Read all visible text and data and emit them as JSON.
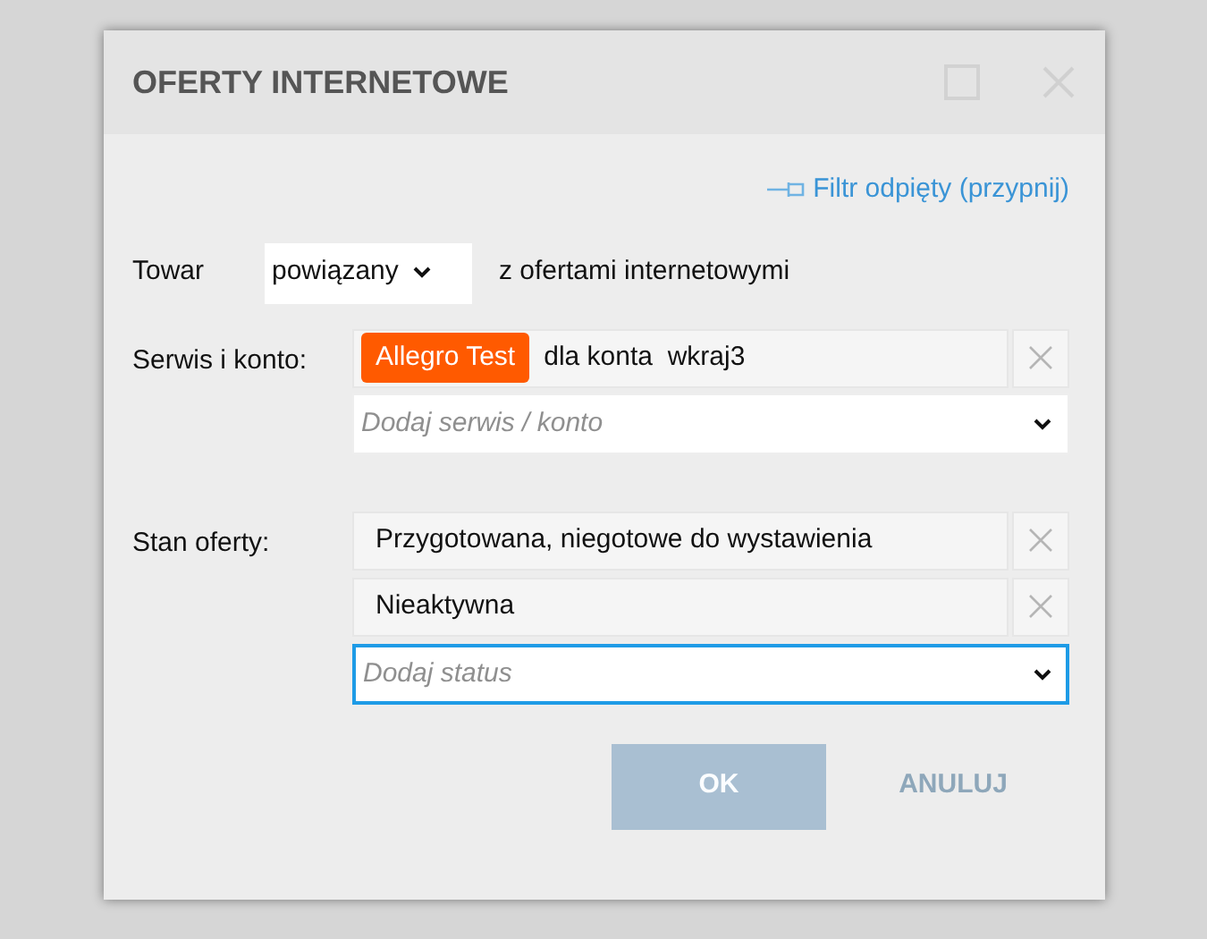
{
  "window": {
    "title": "OFERTY INTERNETOWE"
  },
  "filter_link": "Filtr odpięty (przypnij)",
  "product": {
    "label": "Towar",
    "select_value": "powiązany",
    "suffix": "z ofertami internetowymi"
  },
  "service": {
    "label": "Serwis i konto:",
    "entries": [
      {
        "tag": "Allegro Test",
        "color": "#ff5a00",
        "text": "dla konta  wkraj3"
      }
    ],
    "placeholder": "Dodaj serwis / konto",
    "focused": false
  },
  "status": {
    "label": "Stan oferty:",
    "entries": [
      {
        "text": "Przygotowana, niegotowe do wystawienia"
      },
      {
        "text": "Nieaktywna"
      }
    ],
    "placeholder": "Dodaj status",
    "focused": true
  },
  "buttons": [
    {
      "label": "OK",
      "kind": "primary",
      "disabled": true
    },
    {
      "label": "ANULUJ",
      "kind": "secondary",
      "disabled": true
    }
  ]
}
